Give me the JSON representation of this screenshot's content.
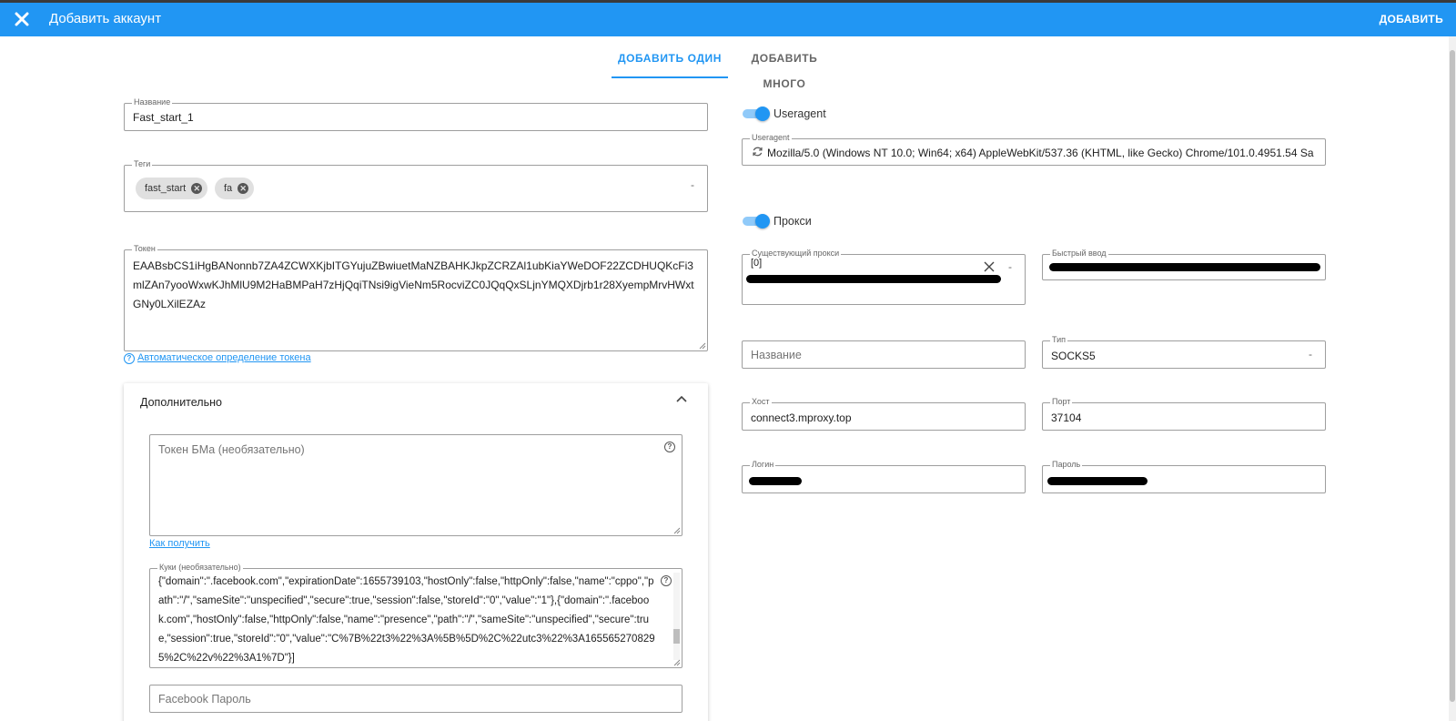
{
  "appbar": {
    "title": "Добавить аккаунт",
    "add_label": "ДОБАВИТЬ"
  },
  "tabs": [
    {
      "label": "ДОБАВИТЬ ОДИН",
      "active": true
    },
    {
      "label": "ДОБАВИТЬ МНОГО",
      "active": false
    }
  ],
  "left": {
    "name": {
      "label": "Название",
      "value": "Fast_start_1"
    },
    "tags": {
      "label": "Теги",
      "chips": [
        "fast_start",
        "fa"
      ],
      "dropdown": "-"
    },
    "token": {
      "label": "Токен",
      "value": "EAABsbCS1iHgBANonnb7ZA4ZCWXKjbITGYujuZBwiuetMaNZBAHKJkpZCRZAl1ubKiaYWeDOF22ZCDHUQKcFi3mlZAn7yooWxwKJhMlU9M2HaBMPaH7zHjQqiTNsi9igVieNm5RocviZC0JQqQxSLjnYMQXDjrb1r28XyempMrvHWxtGNy0LXilEZAz"
    },
    "token_auto_link": "Автоматическое определение токена",
    "extra": {
      "title": "Дополнительно",
      "bm_token": {
        "placeholder": "Токен БМа (необязательно)"
      },
      "how_to_link": "Как получить",
      "cookies": {
        "label": "Куки (необязательно)",
        "value": "{\"domain\":\".facebook.com\",\"expirationDate\":1655739103,\"hostOnly\":false,\"httpOnly\":false,\"name\":\"cppo\",\"path\":\"/\",\"sameSite\":\"unspecified\",\"secure\":true,\"session\":false,\"storeId\":\"0\",\"value\":\"1\"},{\"domain\":\".facebook.com\",\"hostOnly\":false,\"httpOnly\":false,\"name\":\"presence\",\"path\":\"/\",\"sameSite\":\"unspecified\",\"secure\":true,\"session\":true,\"storeId\":\"0\",\"value\":\"C%7B%22t3%22%3A%5B%5D%2C%22utc3%22%3A1655652708295%2C%22v%22%3A1%7D\"}]"
      },
      "fb_password": {
        "placeholder": "Facebook Пароль"
      }
    }
  },
  "right": {
    "useragent_toggle": {
      "label": "Useragent",
      "on": true
    },
    "useragent": {
      "label": "Useragent",
      "value": "Mozilla/5.0 (Windows NT 10.0; Win64; x64) AppleWebKit/537.36 (KHTML, like Gecko) Chrome/101.0.4951.54 Sa"
    },
    "proxy_toggle": {
      "label": "Прокси",
      "on": true
    },
    "existing_proxy": {
      "label": "Существующий прокси",
      "value": "[0]",
      "dropdown": "-"
    },
    "quick_input": {
      "label": "Быстрый ввод"
    },
    "proxy_name": {
      "placeholder": "Название"
    },
    "type": {
      "label": "Тип",
      "value": "SOCKS5",
      "dropdown": "-"
    },
    "host": {
      "label": "Хост",
      "value": "connect3.mproxy.top"
    },
    "port": {
      "label": "Порт",
      "value": "37104"
    },
    "login": {
      "label": "Логин"
    },
    "password": {
      "label": "Пароль"
    }
  },
  "colors": {
    "accent": "#2196f3",
    "toggle_track": "#90caf9"
  }
}
